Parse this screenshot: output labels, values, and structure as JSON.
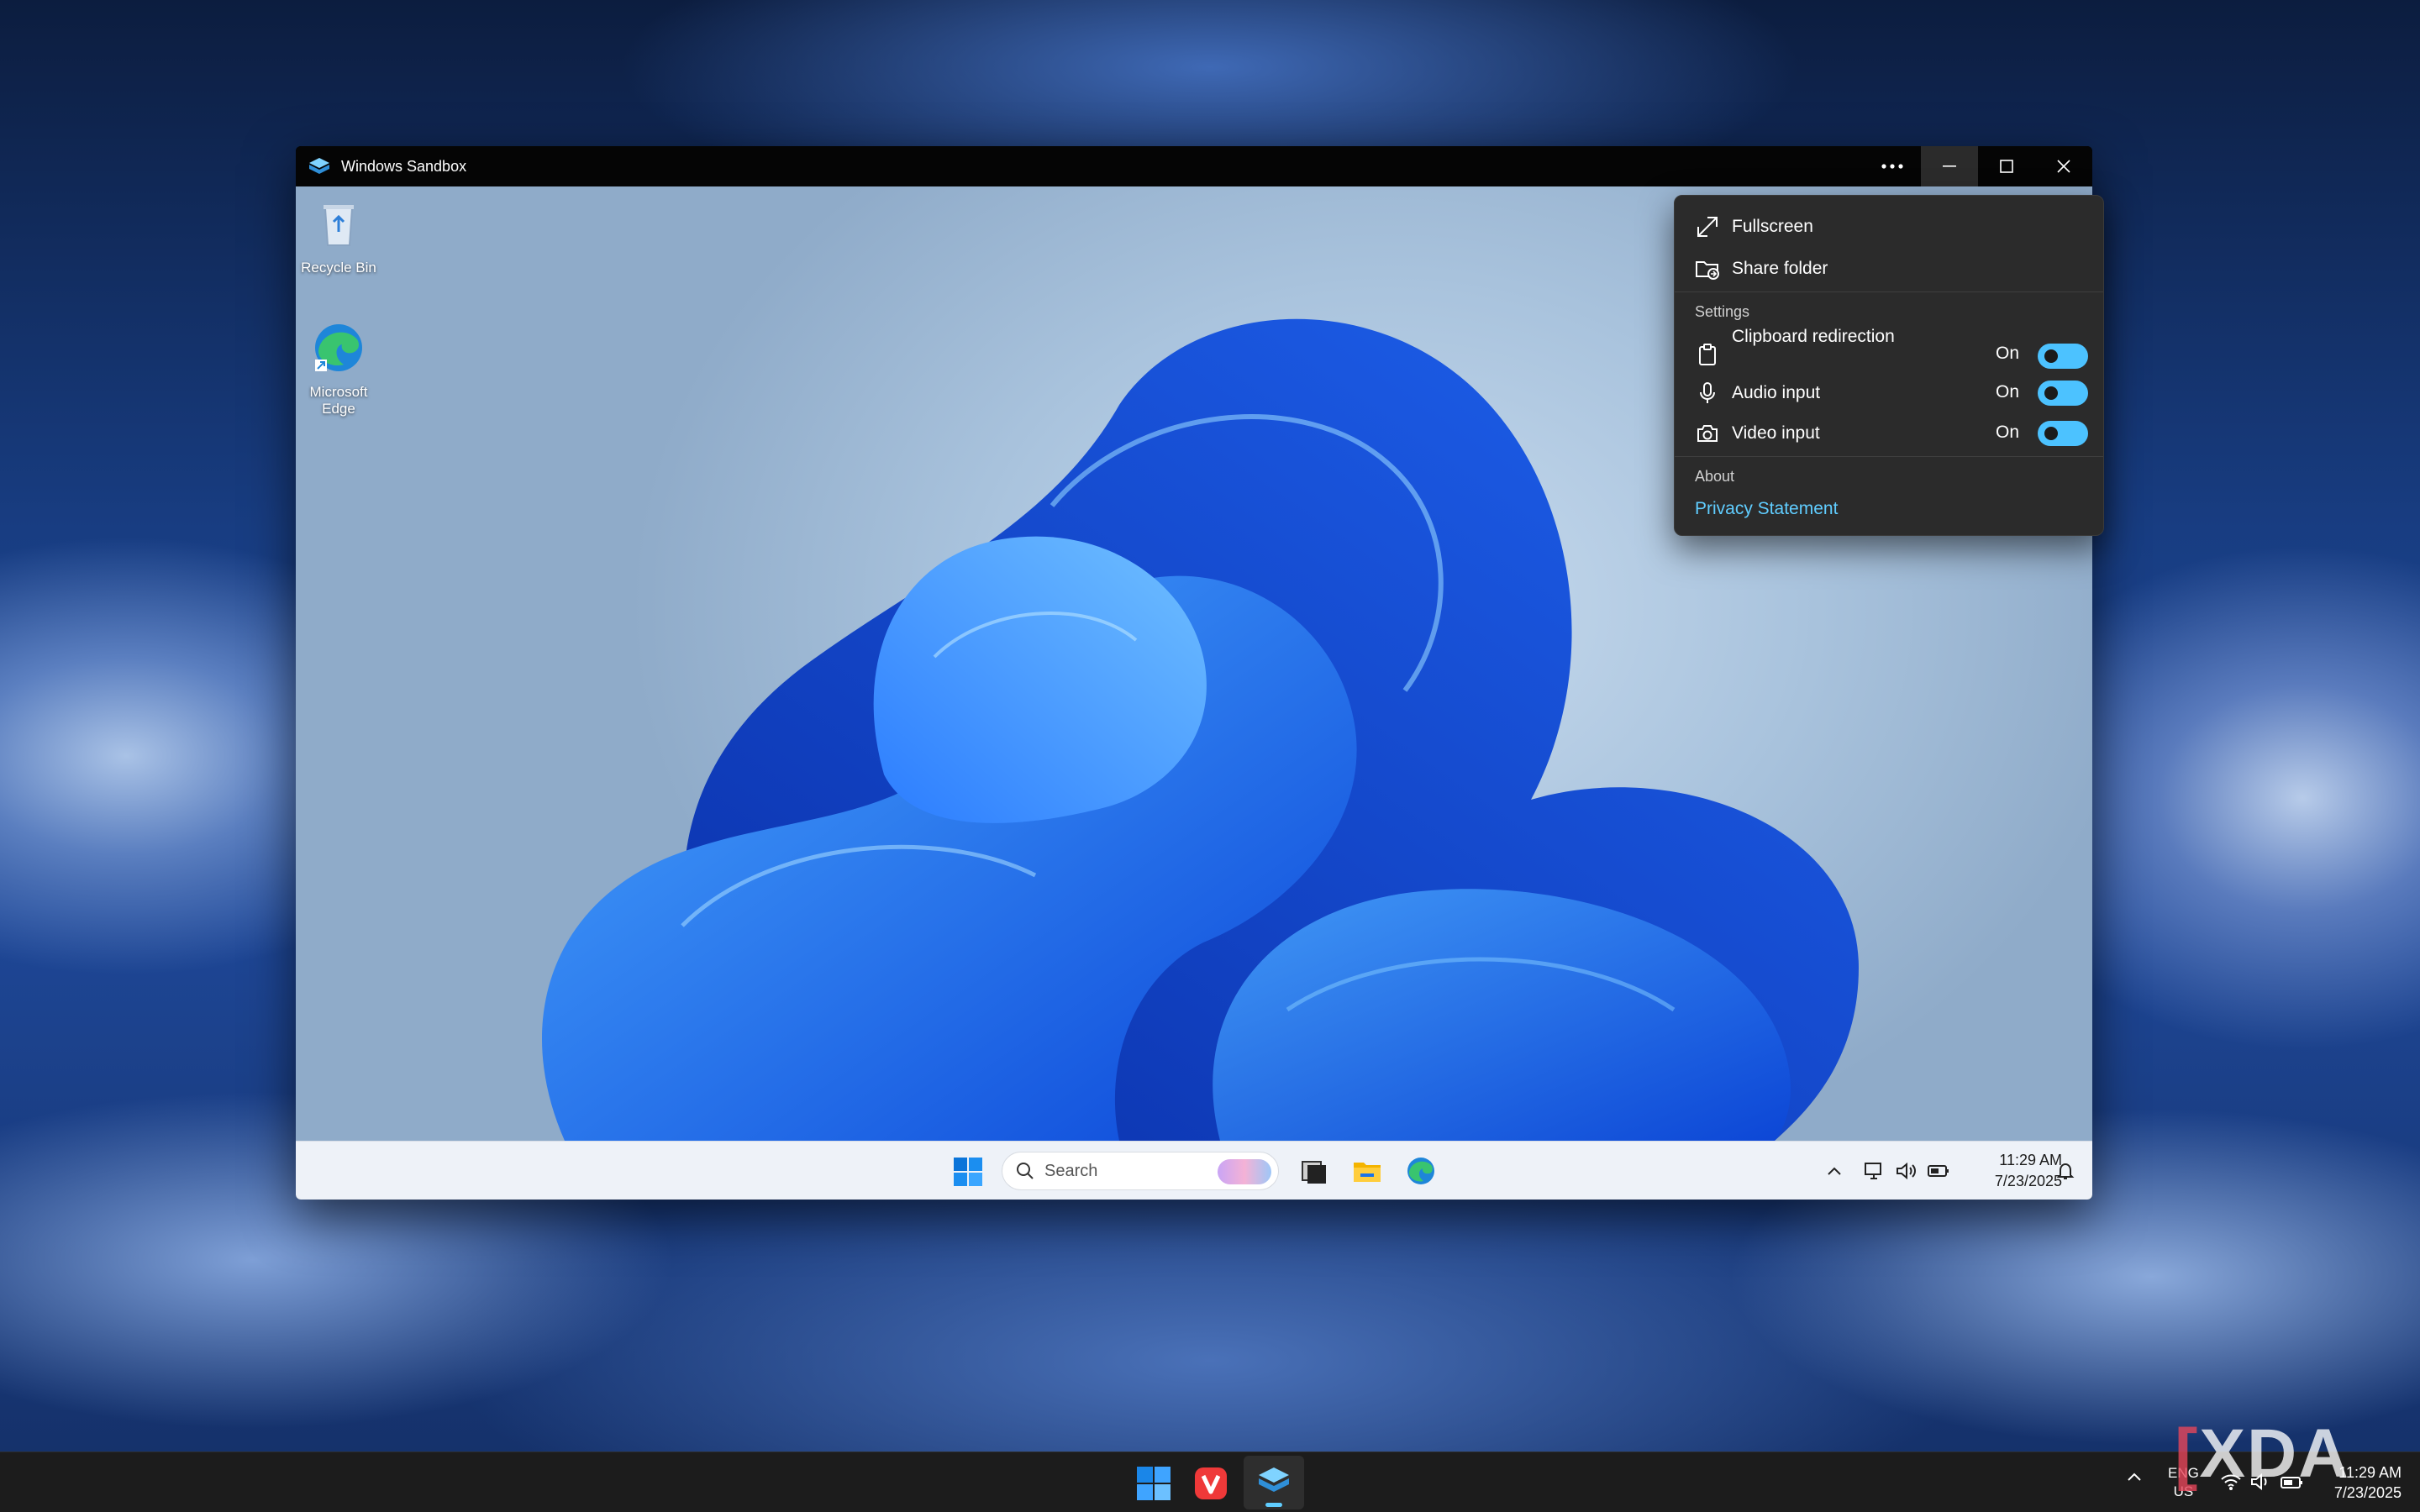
{
  "window": {
    "title": "Windows Sandbox"
  },
  "desktop": {
    "icons": [
      {
        "label": "Recycle Bin",
        "icon": "recycle-bin-icon"
      },
      {
        "label": "Microsoft Edge",
        "icon": "edge-icon"
      }
    ]
  },
  "menu": {
    "fullscreen": "Fullscreen",
    "share_folder": "Share folder",
    "settings_header": "Settings",
    "clipboard": {
      "label": "Clipboard redirection",
      "state": "On"
    },
    "audio": {
      "label": "Audio input",
      "state": "On"
    },
    "video": {
      "label": "Video input",
      "state": "On"
    },
    "about_header": "About",
    "privacy": "Privacy Statement",
    "toggle_color": "#4cc2ff"
  },
  "inner_taskbar": {
    "search_placeholder": "Search",
    "time": "11:29 AM",
    "date": "7/23/2025"
  },
  "host_taskbar": {
    "lang_line1": "ENG",
    "lang_line2": "US",
    "time": "11:29 AM",
    "date": "7/23/2025"
  },
  "watermark": {
    "text": "XDA"
  }
}
